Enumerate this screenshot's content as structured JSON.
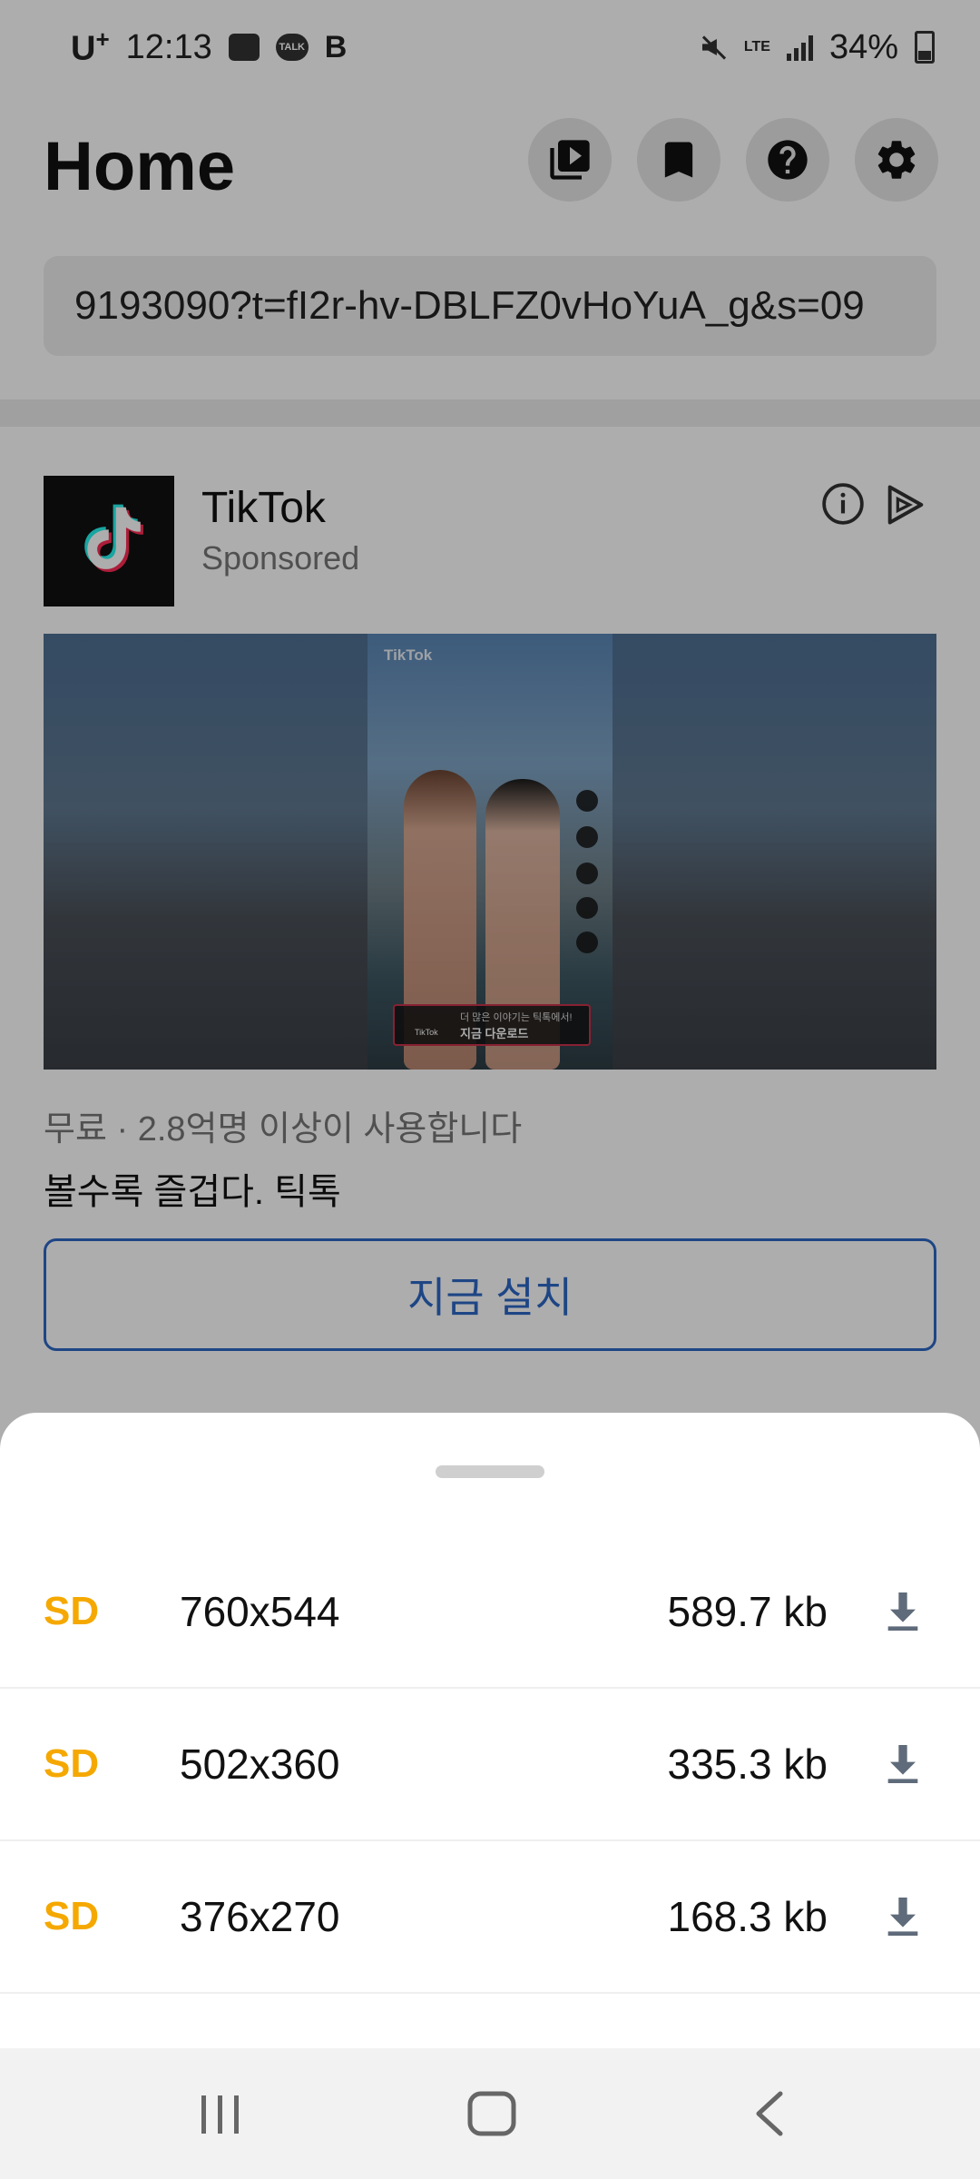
{
  "status_bar": {
    "carrier": "U",
    "carrier_sup": "+",
    "time": "12:13",
    "kakao_label": "TALK",
    "b_label": "B",
    "network": "LTE",
    "battery": "34%"
  },
  "header": {
    "title": "Home"
  },
  "url_field": {
    "value": "9193090?t=fI2r-hv-DBLFZ0vHoYuA_g&s=09"
  },
  "ad": {
    "advertiser": "TikTok",
    "sponsored": "Sponsored",
    "video_watermark": "TikTok",
    "video_cta_line1": "더 많은 이야기는 틱톡에서!",
    "video_cta_line2": "지금 다운로드",
    "video_cta_brand": "TikTok",
    "meta": "무료 · 2.8억명 이상이 사용합니다",
    "description": "볼수록 즐겁다. 틱톡",
    "install_label": "지금 설치"
  },
  "download_options": [
    {
      "quality": "SD",
      "resolution": "760x544",
      "size": "589.7 kb"
    },
    {
      "quality": "SD",
      "resolution": "502x360",
      "size": "335.3 kb"
    },
    {
      "quality": "SD",
      "resolution": "376x270",
      "size": "168.3 kb"
    }
  ],
  "colors": {
    "accent_quality": "#f5a800",
    "install_blue": "#2d67c4",
    "download_icon": "#5f6b7a"
  },
  "icons": {
    "header": [
      "video-library-icon",
      "bookmark-icon",
      "help-icon",
      "settings-icon"
    ],
    "nav": [
      "recents-icon",
      "home-icon",
      "back-icon"
    ]
  }
}
